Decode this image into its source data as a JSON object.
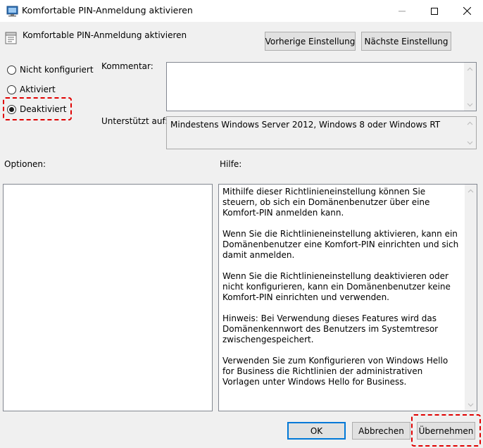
{
  "window": {
    "title": "Komfortable PIN-Anmeldung aktivieren",
    "controls": [
      "minimize-icon",
      "maximize-icon",
      "close-icon"
    ]
  },
  "header": {
    "policy_title": "Komfortable PIN-Anmeldung aktivieren",
    "prev_button": "Vorherige Einstellung",
    "next_button": "Nächste Einstellung"
  },
  "state": {
    "options": [
      {
        "label": "Nicht konfiguriert",
        "checked": false
      },
      {
        "label": "Aktiviert",
        "checked": false
      },
      {
        "label": "Deaktiviert",
        "checked": true
      }
    ]
  },
  "comment": {
    "label": "Kommentar:",
    "value": ""
  },
  "supported": {
    "label": "Unterstützt auf:",
    "value": "Mindestens Windows Server 2012, Windows 8 oder Windows RT"
  },
  "options_panel": {
    "label": "Optionen:"
  },
  "help": {
    "label": "Hilfe:",
    "paragraphs": [
      "Mithilfe dieser Richtlinieneinstellung können Sie steuern, ob sich ein Domänenbenutzer über eine Komfort-PIN anmelden kann.",
      "Wenn Sie die Richtlinieneinstellung aktivieren, kann ein Domänenbenutzer eine Komfort-PIN einrichten und sich damit anmelden.",
      "Wenn Sie die Richtlinieneinstellung deaktivieren oder nicht konfigurieren, kann ein Domänenbenutzer keine Komfort-PIN einrichten und verwenden.",
      "Hinweis: Bei Verwendung dieses Features wird das Domänenkennwort des Benutzers im Systemtresor zwischengespeichert.",
      "Verwenden Sie zum Konfigurieren von Windows Hello for Business die Richtlinien der administrativen Vorlagen unter Windows Hello for Business."
    ]
  },
  "footer": {
    "ok": "OK",
    "cancel": "Abbrechen",
    "apply": "Übernehmen"
  },
  "colors": {
    "highlight": "#e00000",
    "default_button_border": "#0078d7",
    "window_bg": "#f0f0f0"
  }
}
